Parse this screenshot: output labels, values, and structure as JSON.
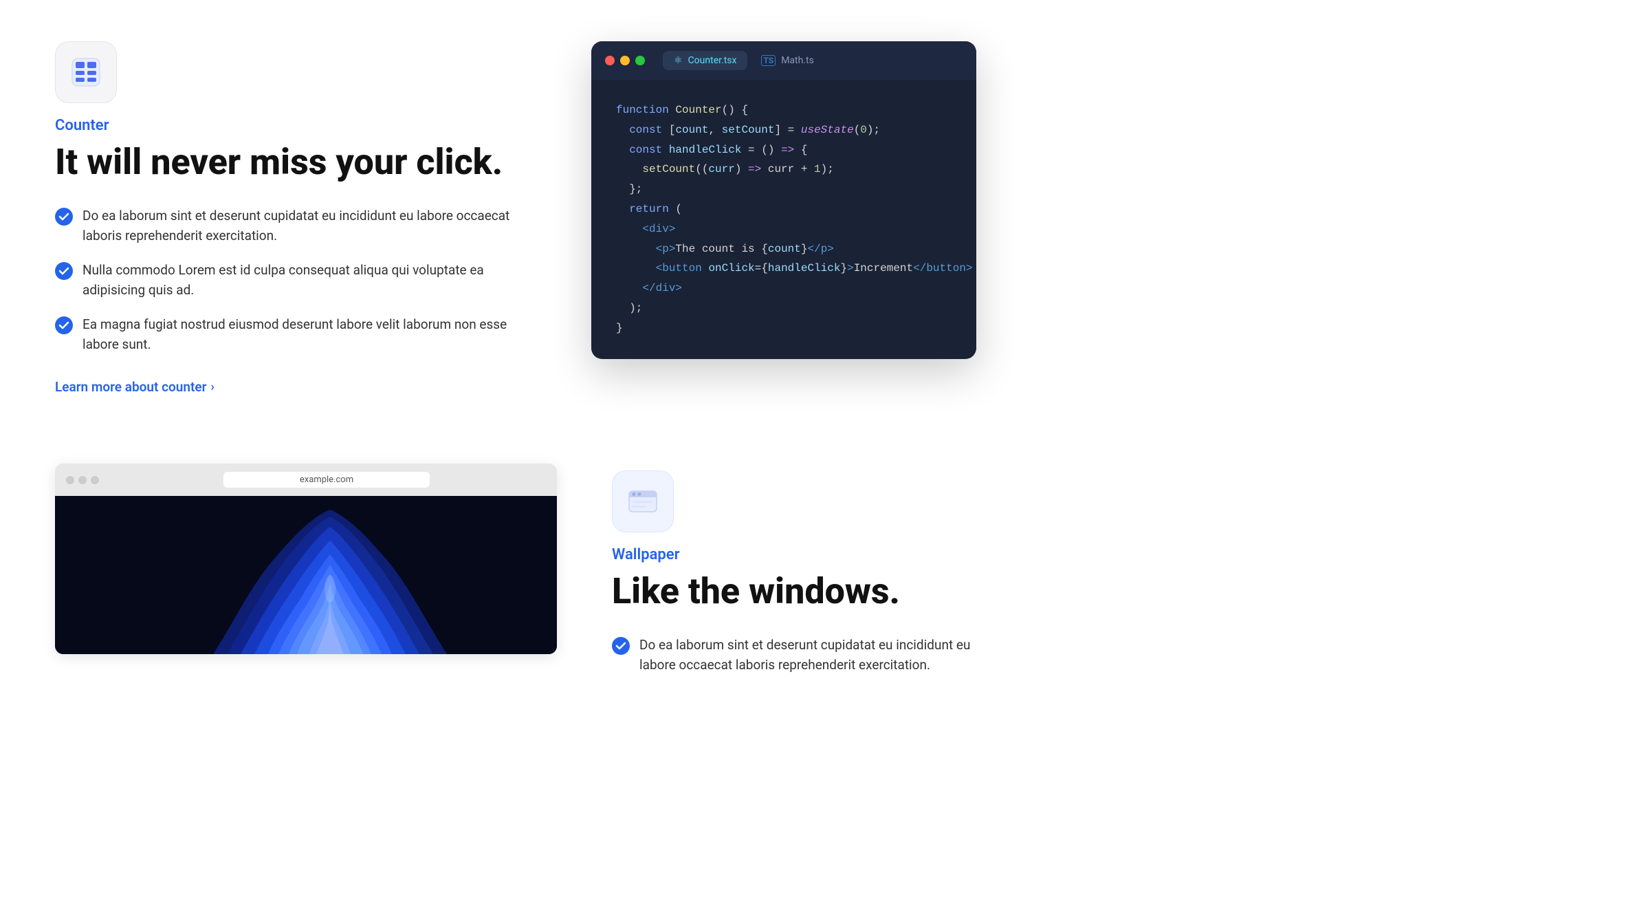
{
  "counter_section": {
    "tag": "Counter",
    "headline": "It will never miss your click.",
    "features": [
      "Do ea laborum sint et deserunt cupidatat eu incididunt eu labore occaecat laboris reprehenderit exercitation.",
      "Nulla commodo Lorem est id culpa consequat aliqua qui voluptate ea adipisicing quis ad.",
      "Ea magna fugiat nostrud eiusmod deserunt labore velit laborum non esse labore sunt."
    ],
    "learn_more": "Learn more about counter",
    "code_tab1": "Counter.tsx",
    "code_tab2": "Math.ts"
  },
  "wallpaper_section": {
    "tag": "Wallpaper",
    "headline": "Like the windows.",
    "features": [
      "Do ea laborum sint et deserunt cupidatat eu incididunt eu labore occaecat laboris reprehenderit exercitation."
    ],
    "browser_url": "example.com"
  }
}
